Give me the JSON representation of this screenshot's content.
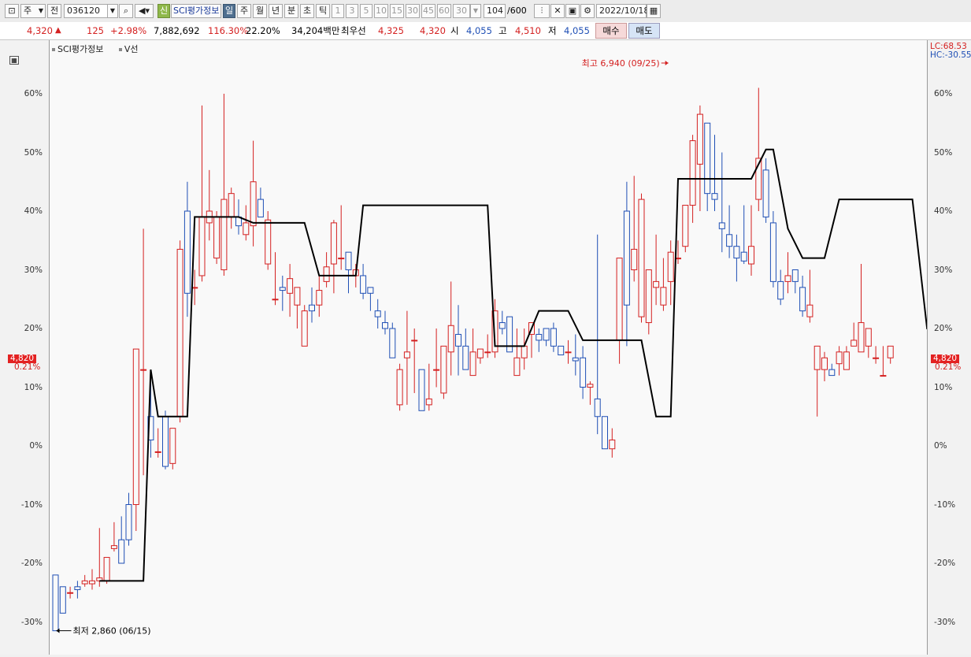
{
  "toolbar": {
    "market": "주",
    "prev_label": "전",
    "code": "036120",
    "sci_label": "신",
    "name": "SCI평가정보",
    "periods": [
      "일",
      "주",
      "월",
      "년",
      "분",
      "초",
      "틱"
    ],
    "active_period": "일",
    "intervals": [
      "1",
      "3",
      "5",
      "10",
      "15",
      "30",
      "45",
      "60"
    ],
    "interval_value": "30",
    "count": "104",
    "count_total": "/600",
    "date": "2022/10/18"
  },
  "infobar": {
    "price": "4,320",
    "change": "125",
    "change_pct": "+2.98%",
    "volume": "7,882,692",
    "vol_ratio": "116.30%",
    "turnover": "22.20%",
    "amount": "34,204백만",
    "best_label": "최우선",
    "best_ask": "4,325",
    "best_bid": "4,320",
    "open_label": "시",
    "open": "4,055",
    "high_label": "고",
    "high": "4,510",
    "low_label": "저",
    "low": "4,055",
    "buy_label": "매수",
    "sell_label": "매도"
  },
  "legend": {
    "item1": "SCI평가정보",
    "item2": "V선"
  },
  "lc_label": "LC:68.53",
  "hc_label": "HC:-30.55",
  "price_tag": {
    "price": "4,820",
    "pct": "0.21%"
  },
  "colors": {
    "up": "#d42020",
    "down": "#1f4fb5",
    "vline": "#000000"
  },
  "chart_data": {
    "type": "candlestick",
    "yaxis_ticks": [
      "60%",
      "50%",
      "40%",
      "30%",
      "20%",
      "10%",
      "0%",
      "-10%",
      "-20%",
      "-30%"
    ],
    "annotations": {
      "high": "최고 6,940 (09/25)",
      "low": "최저 2,860 (06/15)"
    },
    "candles": [
      [
        -22,
        -22,
        -31.5,
        -31.5
      ],
      [
        -24,
        -24,
        -28.5,
        -28.5
      ],
      [
        -25,
        -24,
        -26,
        -25
      ],
      [
        -24,
        -23,
        -26,
        -24.5
      ],
      [
        -23.5,
        -22,
        -24,
        -23
      ],
      [
        -23.5,
        -21,
        -24.5,
        -23
      ],
      [
        -23,
        -14,
        -24,
        -22.5
      ],
      [
        -23,
        -19,
        -23.5,
        -19
      ],
      [
        -17.5,
        -13,
        -18,
        -17
      ],
      [
        -16,
        -12,
        -20,
        -20
      ],
      [
        -10,
        -8,
        -17,
        -16
      ],
      [
        -10,
        -10,
        -14.5,
        16.5
      ],
      [
        13,
        37,
        -5,
        13
      ],
      [
        5,
        12,
        -2,
        1
      ],
      [
        -1,
        3,
        -2,
        -1
      ],
      [
        5,
        6,
        -4,
        -3.5
      ],
      [
        -3,
        -2,
        -4,
        3
      ],
      [
        5,
        35,
        4,
        33.5
      ],
      [
        40,
        45,
        22,
        26
      ],
      [
        27,
        30,
        24,
        27
      ],
      [
        29,
        58,
        28,
        39
      ],
      [
        38,
        47,
        35,
        40
      ],
      [
        32,
        40,
        31,
        39
      ],
      [
        30,
        60,
        29,
        42
      ],
      [
        39,
        44,
        37,
        43
      ],
      [
        39,
        42,
        36,
        37.5
      ],
      [
        36,
        41,
        35,
        38
      ],
      [
        37.5,
        52,
        34,
        45
      ],
      [
        42,
        44,
        39,
        39
      ],
      [
        31,
        40,
        30,
        38.5
      ],
      [
        25,
        33,
        24,
        25
      ],
      [
        27,
        29,
        23,
        26.5
      ],
      [
        26,
        31,
        22,
        28.5
      ],
      [
        24,
        27,
        20,
        27
      ],
      [
        17,
        24,
        17,
        23
      ],
      [
        24,
        27,
        21,
        23
      ],
      [
        24,
        29,
        22,
        26.5
      ],
      [
        28,
        33,
        27,
        30.5
      ],
      [
        31,
        38.5,
        26,
        38
      ],
      [
        32,
        41,
        30,
        32
      ],
      [
        33,
        33,
        26,
        30
      ],
      [
        29,
        31,
        27,
        30
      ],
      [
        29,
        31,
        25,
        26
      ],
      [
        27,
        27,
        23,
        26
      ],
      [
        23,
        25,
        20,
        22
      ],
      [
        21,
        23,
        19,
        20
      ],
      [
        20,
        21,
        15,
        15
      ],
      [
        7,
        14,
        6,
        13
      ],
      [
        15,
        23,
        7,
        16
      ],
      [
        18,
        20,
        9,
        18
      ],
      [
        13,
        13,
        6,
        6
      ],
      [
        7,
        14,
        6,
        8
      ],
      [
        13,
        20,
        10,
        13
      ],
      [
        9,
        17,
        8,
        17
      ],
      [
        16,
        28,
        12,
        20.5
      ],
      [
        19,
        24,
        12,
        17
      ],
      [
        17,
        20,
        15,
        13
      ],
      [
        12,
        20,
        12,
        16
      ],
      [
        15,
        15,
        14,
        16.5
      ],
      [
        16,
        19,
        15,
        16
      ],
      [
        16,
        25,
        15,
        23
      ],
      [
        21,
        23,
        19,
        20
      ],
      [
        22,
        22,
        16,
        16
      ],
      [
        12,
        20,
        12,
        15
      ],
      [
        15,
        20,
        13,
        17
      ],
      [
        19,
        21,
        15,
        21
      ],
      [
        19,
        20,
        16,
        18
      ],
      [
        20,
        20,
        17,
        18
      ],
      [
        20,
        21,
        16,
        17
      ],
      [
        17,
        17,
        16,
        15.5
      ],
      [
        16,
        18,
        14,
        16
      ],
      [
        15,
        19,
        12,
        14.5
      ],
      [
        15,
        17,
        8,
        10
      ],
      [
        10,
        11,
        7,
        10.5
      ],
      [
        8,
        36,
        2,
        5
      ],
      [
        5,
        5,
        -0.5,
        -0.5
      ],
      [
        -0.5,
        3,
        -2,
        1
      ],
      [
        18,
        32,
        14,
        32
      ],
      [
        40,
        45,
        17,
        24
      ],
      [
        30,
        46,
        28,
        33.5
      ],
      [
        22,
        43,
        21,
        42
      ],
      [
        21,
        30,
        19,
        30
      ],
      [
        27,
        36,
        24,
        28
      ],
      [
        24,
        32,
        23,
        27
      ],
      [
        28,
        35,
        24,
        33
      ],
      [
        32,
        35,
        31,
        32
      ],
      [
        34,
        40,
        33,
        41
      ],
      [
        41,
        53,
        38,
        52
      ],
      [
        48,
        58,
        40,
        56.5
      ],
      [
        55,
        52,
        40,
        43
      ],
      [
        43,
        53,
        40,
        42
      ],
      [
        38,
        50,
        33,
        37
      ],
      [
        36,
        41,
        32,
        34
      ],
      [
        34,
        36,
        28,
        32
      ],
      [
        33,
        41,
        31,
        31.5
      ],
      [
        31,
        41,
        29,
        34
      ],
      [
        42,
        61,
        40,
        49
      ],
      [
        47,
        49,
        38,
        39
      ],
      [
        38,
        40,
        27,
        28
      ],
      [
        28,
        30,
        24,
        25
      ],
      [
        28,
        33,
        26,
        29
      ],
      [
        30,
        30,
        26,
        28
      ],
      [
        27,
        29,
        22,
        23
      ],
      [
        22,
        30,
        21,
        24
      ],
      [
        13,
        17,
        5,
        17
      ],
      [
        13,
        16,
        11,
        15
      ],
      [
        13,
        14,
        12,
        12
      ],
      [
        14,
        17,
        12,
        16
      ],
      [
        13,
        17,
        13,
        16
      ],
      [
        17,
        21,
        17,
        18
      ],
      [
        16,
        31,
        16,
        21
      ],
      [
        17,
        20,
        15,
        20
      ],
      [
        15,
        17,
        14,
        15
      ],
      [
        12,
        17,
        12,
        12
      ],
      [
        15,
        16,
        14,
        17
      ]
    ]
  }
}
